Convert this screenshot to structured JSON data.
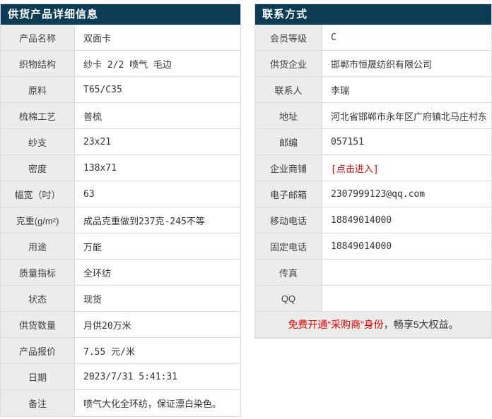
{
  "colors": {
    "header_bg": "#0d3c55",
    "header_text": "#ffffff",
    "label_bg": "#ececec",
    "border": "#dcdcdc",
    "accent_red": "#e60000",
    "value_text": "#333333"
  },
  "left_table": {
    "title": "供货产品详细信息",
    "rows": [
      {
        "label": "产品名称",
        "value": "双面卡"
      },
      {
        "label": "织物结构",
        "value": "纱卡 2/2 喷气 毛边"
      },
      {
        "label": "原料",
        "value": "T65/C35"
      },
      {
        "label": "梳棉工艺",
        "value": "普梳"
      },
      {
        "label": "纱支",
        "value": "23x21"
      },
      {
        "label": "密度",
        "value": "138x71"
      },
      {
        "label": "幅宽（吋）",
        "value": "63"
      },
      {
        "label": "克重(g/m²)",
        "value": "成品克重做到237克-245不等"
      },
      {
        "label": "用途",
        "value": "万能"
      },
      {
        "label": "质量指标",
        "value": "全环纺"
      },
      {
        "label": "状态",
        "value": "现货"
      },
      {
        "label": "供货数量",
        "value": "月供20万米"
      },
      {
        "label": "产品报价",
        "value": "7.55 元/米"
      },
      {
        "label": "日期",
        "value": "2023/7/31 5:41:31"
      },
      {
        "label": "备注",
        "value": "喷气大化全环纺，保证漂白染色。"
      }
    ]
  },
  "right_table": {
    "title": "联系方式",
    "rows": [
      {
        "label": "会员等级",
        "value": "C"
      },
      {
        "label": "供货企业",
        "value": "邯郸市恒晟纺织有限公司"
      },
      {
        "label": "联系人",
        "value": "李瑞"
      },
      {
        "label": "地址",
        "value": "河北省邯郸市永年区广府镇北马庄村东"
      },
      {
        "label": "邮编",
        "value": "057151"
      },
      {
        "label": "企业商铺",
        "value": "[点击进入]"
      },
      {
        "label": "电子邮箱",
        "value": "2307999123@qq.com"
      },
      {
        "label": "移动电话",
        "value": "18849014000"
      },
      {
        "label": "固定电话",
        "value": "18849014000"
      },
      {
        "label": "传真",
        "value": ""
      },
      {
        "label": "QQ",
        "value": ""
      }
    ],
    "footer": {
      "highlight": "免费开通“采购商”身份",
      "rest": "，畅享5大权益。"
    }
  }
}
